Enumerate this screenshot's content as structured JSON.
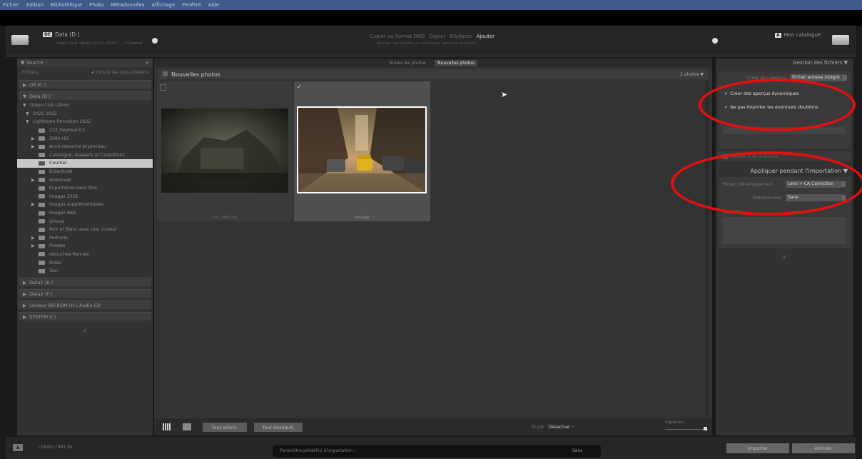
{
  "menu": [
    "Fichier",
    "Edition",
    "Bibliothèque",
    "Photo",
    "Métadonnées",
    "Affichage",
    "Fenêtre",
    "Aide"
  ],
  "header": {
    "source_badge": "DE",
    "source_drive": "Data (D:)",
    "source_path": "Diapo Club Lithon \\ 2021-2022 \\ ... \\ Courriel",
    "modes": [
      "Copier au format DNG",
      "Copier",
      "Déplacer",
      "Ajouter"
    ],
    "mode_active": "Ajouter",
    "mode_subtitle": "Ajouter des photos au catalogue sans les déplacer",
    "dest_badge": "A",
    "dest_label": "Mon catalogue"
  },
  "left": {
    "source_title": "Source",
    "fichiers_label": "Fichiers",
    "include_sub": "Inclure les sous-dossiers",
    "drives": [
      {
        "label": "OS (C:)"
      },
      {
        "label": "Data (D:)"
      }
    ],
    "tree": [
      {
        "label": "Diapo Club Lithon",
        "level": 0,
        "folder": false,
        "tri": "▼"
      },
      {
        "label": "2021-2022",
        "level": 1,
        "folder": false,
        "tri": "▼"
      },
      {
        "label": "Lightroom formation 2022",
        "level": 1,
        "folder": false,
        "tri": "▼"
      },
      {
        "label": "212_Keyboard 2",
        "level": 2,
        "folder": true,
        "tri": ""
      },
      {
        "label": "1080 HD",
        "level": 2,
        "folder": true,
        "tri": "▶"
      },
      {
        "label": "Acné retouche et pinceau",
        "level": 2,
        "folder": true,
        "tri": "▶"
      },
      {
        "label": "Catalogue, Dossiers et Collections",
        "level": 2,
        "folder": true,
        "tri": ""
      },
      {
        "label": "Courriel",
        "level": 2,
        "folder": true,
        "tri": "",
        "selected": true
      },
      {
        "label": "Didacticiel",
        "level": 2,
        "folder": true,
        "tri": ""
      },
      {
        "label": "download",
        "level": 2,
        "folder": true,
        "tri": "▶"
      },
      {
        "label": "Exportation sans titre",
        "level": 2,
        "folder": true,
        "tri": ""
      },
      {
        "label": "images 2022",
        "level": 2,
        "folder": true,
        "tri": ""
      },
      {
        "label": "Images supplémentaires",
        "level": 2,
        "folder": true,
        "tri": "▶"
      },
      {
        "label": "Images Web",
        "level": 2,
        "folder": true,
        "tri": ""
      },
      {
        "label": "Iphone",
        "level": 2,
        "folder": true,
        "tri": ""
      },
      {
        "label": "Noir et Blanc avec une couleur",
        "level": 2,
        "folder": true,
        "tri": ""
      },
      {
        "label": "Portraits",
        "level": 2,
        "folder": true,
        "tri": "▶"
      },
      {
        "label": "Presets",
        "level": 2,
        "folder": true,
        "tri": "▶"
      },
      {
        "label": "retouches Rennes",
        "level": 2,
        "folder": true,
        "tri": ""
      },
      {
        "label": "Rides",
        "level": 2,
        "folder": true,
        "tri": ""
      },
      {
        "label": "Taxi",
        "level": 2,
        "folder": true,
        "tri": ""
      }
    ],
    "other_drives": [
      "Data1 (E:)",
      "Data2 (F:)",
      "Lecteur BD-ROM (H:) Audio CD",
      "SYSTEM (I:)"
    ]
  },
  "center": {
    "tabs": [
      "Toutes les photos",
      "Nouvelles photos"
    ],
    "active_tab": "Nouvelles photos",
    "group_title": "Nouvelles photos",
    "count": "2 photos",
    "photos": [
      {
        "filename": "DSC_0009.jpg",
        "checked": false
      },
      {
        "filename": "taxi.jpg",
        "checked": true
      }
    ],
    "select_all": "Tout sélect.",
    "deselect_all": "Tout désélect.",
    "sort_label": "Tri par :",
    "sort_value": "Désactivé",
    "thumbs_label": "Vignettes"
  },
  "right": {
    "section1_title": "Gestion des fichiers",
    "previews_label": "Créer des aperçus",
    "previews_value": "Fichier annexe intégré",
    "smart_previews": "Créer des aperçus dynamiques",
    "no_duplicates": "Ne pas importer les éventuels doublons",
    "add_collection": "Ajouter à la collection",
    "section2_title": "Appliquer pendant l'importation",
    "dev_label": "Param. développement",
    "dev_value": "Lens + CA Correction",
    "meta_label": "Métadonnées",
    "meta_value": "Sans",
    "keywords_label": "Mots-clés"
  },
  "footer": {
    "status": "1 photo / 981 Ko",
    "preset_label": "Paramètre prédéfini d'importation :",
    "preset_value": "Sans",
    "import_btn": "Importer",
    "cancel_btn": "Annuler"
  }
}
